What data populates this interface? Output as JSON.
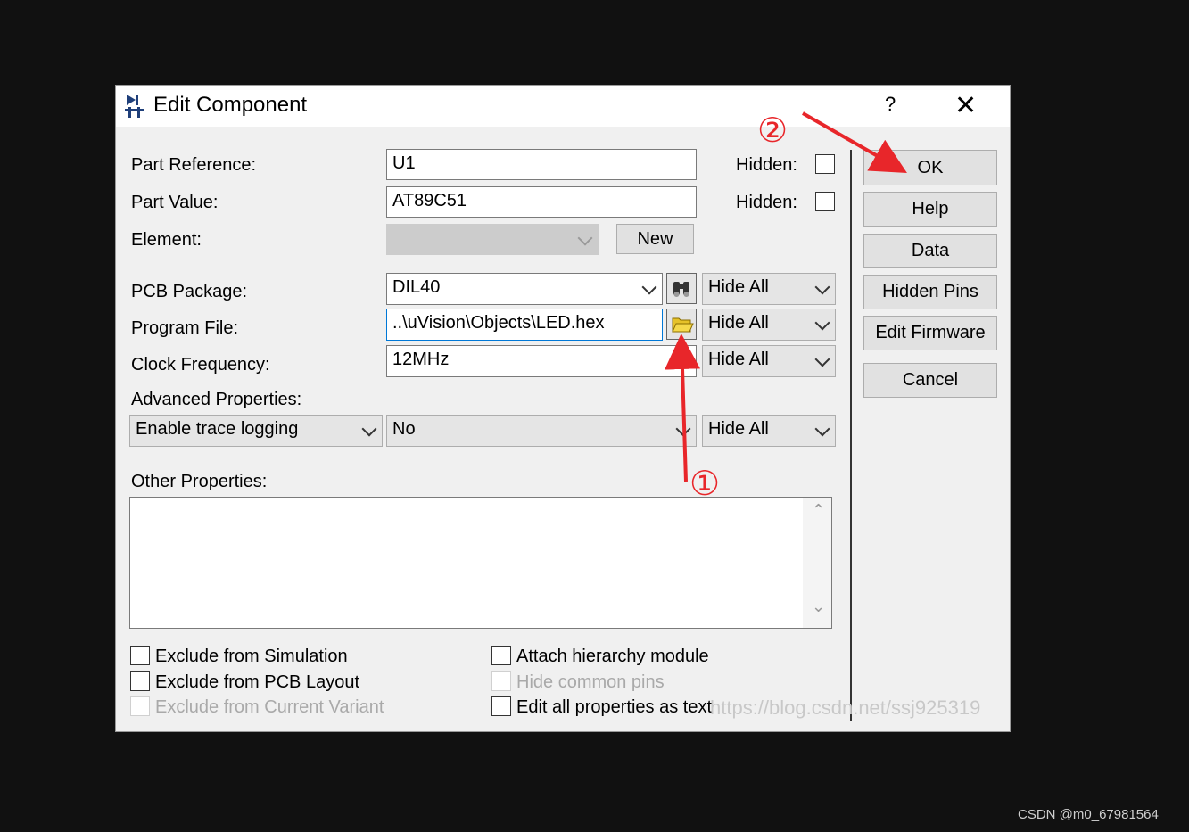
{
  "dialog": {
    "title": "Edit Component",
    "help_label": "?",
    "close_label": "✕"
  },
  "fields": {
    "part_reference": {
      "label": "Part Reference:",
      "value": "U1",
      "hidden_label": "Hidden:"
    },
    "part_value": {
      "label": "Part Value:",
      "value": "AT89C51",
      "hidden_label": "Hidden:"
    },
    "element": {
      "label": "Element:",
      "new_label": "New"
    },
    "pcb_package": {
      "label": "PCB Package:",
      "value": "DIL40",
      "visibility": "Hide All"
    },
    "program_file": {
      "label": "Program File:",
      "value": "..\\uVision\\Objects\\LED.hex",
      "visibility": "Hide All"
    },
    "clock_frequency": {
      "label": "Clock Frequency:",
      "value": "12MHz",
      "visibility": "Hide All"
    },
    "advanced": {
      "label": "Advanced Properties:",
      "property": "Enable trace logging",
      "value": "No",
      "visibility": "Hide All"
    },
    "other": {
      "label": "Other Properties:",
      "scroll_up": "⌃",
      "scroll_down": "⌄"
    }
  },
  "checkboxes": {
    "exclude_simulation": "Exclude from Simulation",
    "exclude_pcb": "Exclude from PCB Layout",
    "exclude_variant": "Exclude from Current Variant",
    "attach_hierarchy": "Attach hierarchy module",
    "hide_common_pins": "Hide common pins",
    "edit_as_text": "Edit all properties as text"
  },
  "buttons": {
    "ok": "OK",
    "help": "Help",
    "data": "Data",
    "hidden_pins": "Hidden Pins",
    "edit_firmware": "Edit Firmware",
    "cancel": "Cancel"
  },
  "annotations": {
    "step1": "①",
    "step2": "②",
    "color": "#e8262a"
  },
  "watermarks": {
    "blog": "https://blog.csdn.net/ssj925319",
    "csdn": "CSDN @m0_67981564"
  },
  "icons": {
    "app": "component-icon",
    "binoculars": "binoculars-icon",
    "folder": "folder-open-icon"
  }
}
